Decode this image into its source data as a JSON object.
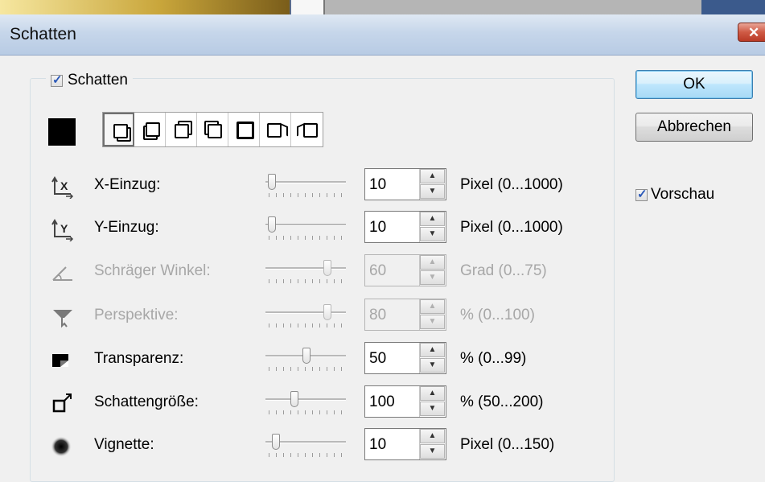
{
  "window": {
    "title": "Schatten",
    "close_glyph": "✕"
  },
  "group": {
    "checkbox_label": "Schatten",
    "checked": true
  },
  "color_swatch": {
    "color": "#000000"
  },
  "shadow_types": [
    {
      "name": "bottom-right",
      "selected": true
    },
    {
      "name": "bottom-left"
    },
    {
      "name": "top-right"
    },
    {
      "name": "top-left"
    },
    {
      "name": "all-around"
    },
    {
      "name": "perspective-right"
    },
    {
      "name": "perspective-left"
    }
  ],
  "rows": [
    {
      "label": "X-Einzug:",
      "value": "10",
      "unit": "Pixel (0...1000)",
      "level": 0.01,
      "enabled": true,
      "icon": "x-offset-icon"
    },
    {
      "label": "Y-Einzug:",
      "value": "10",
      "unit": "Pixel (0...1000)",
      "level": 0.01,
      "enabled": true,
      "icon": "y-offset-icon"
    },
    {
      "label": "Schräger Winkel:",
      "value": "60",
      "unit": "Grad (0...75)",
      "level": 0.8,
      "enabled": false,
      "icon": "angle-icon"
    },
    {
      "label": "Perspektive:",
      "value": "80",
      "unit": "% (0...100)",
      "level": 0.8,
      "enabled": false,
      "icon": "perspective-icon"
    },
    {
      "label": "Transparenz:",
      "value": "50",
      "unit": "% (0...99)",
      "level": 0.5,
      "enabled": true,
      "icon": "transparency-icon"
    },
    {
      "label": "Schattengröße:",
      "value": "100",
      "unit": "% (50...200)",
      "level": 0.33,
      "enabled": true,
      "icon": "shadow-size-icon"
    },
    {
      "label": "Vignette:",
      "value": "10",
      "unit": "Pixel (0...150)",
      "level": 0.07,
      "enabled": true,
      "icon": "vignette-icon"
    }
  ],
  "buttons": {
    "ok": "OK",
    "cancel": "Abbrechen"
  },
  "preview": {
    "label": "Vorschau",
    "checked": true
  },
  "spin": {
    "up": "▲",
    "down": "▼"
  }
}
